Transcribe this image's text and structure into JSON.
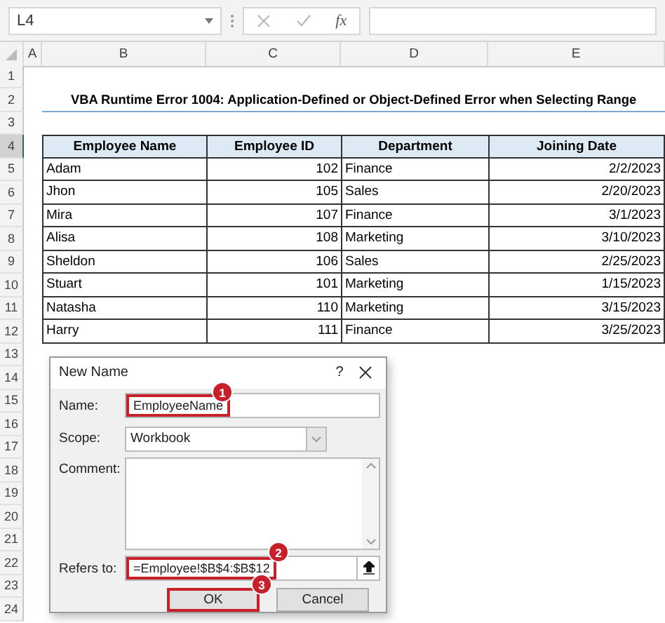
{
  "name_box": "L4",
  "formula_bar": {
    "function_label": "fx"
  },
  "column_headers": [
    "A",
    "B",
    "C",
    "D",
    "E"
  ],
  "row_headers": [
    {
      "label": "1",
      "selected": false
    },
    {
      "label": "2",
      "selected": false
    },
    {
      "label": "3",
      "selected": false
    },
    {
      "label": "4",
      "selected": true
    },
    {
      "label": "5",
      "selected": false
    },
    {
      "label": "6",
      "selected": false
    },
    {
      "label": "7",
      "selected": false
    },
    {
      "label": "8",
      "selected": false
    },
    {
      "label": "9",
      "selected": false
    },
    {
      "label": "10",
      "selected": false
    },
    {
      "label": "11",
      "selected": false
    },
    {
      "label": "12",
      "selected": false
    },
    {
      "label": "13",
      "selected": false
    },
    {
      "label": "14",
      "selected": false
    },
    {
      "label": "15",
      "selected": false
    },
    {
      "label": "16",
      "selected": false
    },
    {
      "label": "17",
      "selected": false
    },
    {
      "label": "18",
      "selected": false
    },
    {
      "label": "19",
      "selected": false
    },
    {
      "label": "20",
      "selected": false
    },
    {
      "label": "21",
      "selected": false
    },
    {
      "label": "22",
      "selected": false
    },
    {
      "label": "23",
      "selected": false
    },
    {
      "label": "24",
      "selected": false
    }
  ],
  "sheet_title": "VBA Runtime Error 1004: Application-Defined or Object-Defined Error when Selecting Range",
  "table": {
    "columns": [
      "Employee Name",
      "Employee ID",
      "Department",
      "Joining Date"
    ],
    "rows": [
      [
        "Adam",
        "102",
        "Finance",
        "2/2/2023"
      ],
      [
        "Jhon",
        "105",
        "Sales",
        "2/20/2023"
      ],
      [
        "Mira",
        "107",
        "Finance",
        "3/1/2023"
      ],
      [
        "Alisa",
        "108",
        "Marketing",
        "3/10/2023"
      ],
      [
        "Sheldon",
        "106",
        "Sales",
        "2/25/2023"
      ],
      [
        "Stuart",
        "101",
        "Marketing",
        "1/15/2023"
      ],
      [
        "Natasha",
        "110",
        "Marketing",
        "3/15/2023"
      ],
      [
        "Harry",
        "111",
        "Finance",
        "3/25/2023"
      ]
    ]
  },
  "dialog": {
    "title": "New Name",
    "help": "?",
    "name": {
      "label": "Name:",
      "value": "EmployeeName",
      "highlighted": true,
      "badge": "1"
    },
    "scope": {
      "label": "Scope:",
      "value": "Workbook"
    },
    "comment": {
      "label": "Comment:"
    },
    "refers_to": {
      "label": "Refers to:",
      "value": "=Employee!$B$4:$B$12",
      "highlighted": true,
      "badge": "2"
    },
    "buttons": [
      {
        "label": "OK",
        "highlighted": true,
        "badge": "3"
      },
      {
        "label": "Cancel",
        "highlighted": false
      }
    ]
  }
}
